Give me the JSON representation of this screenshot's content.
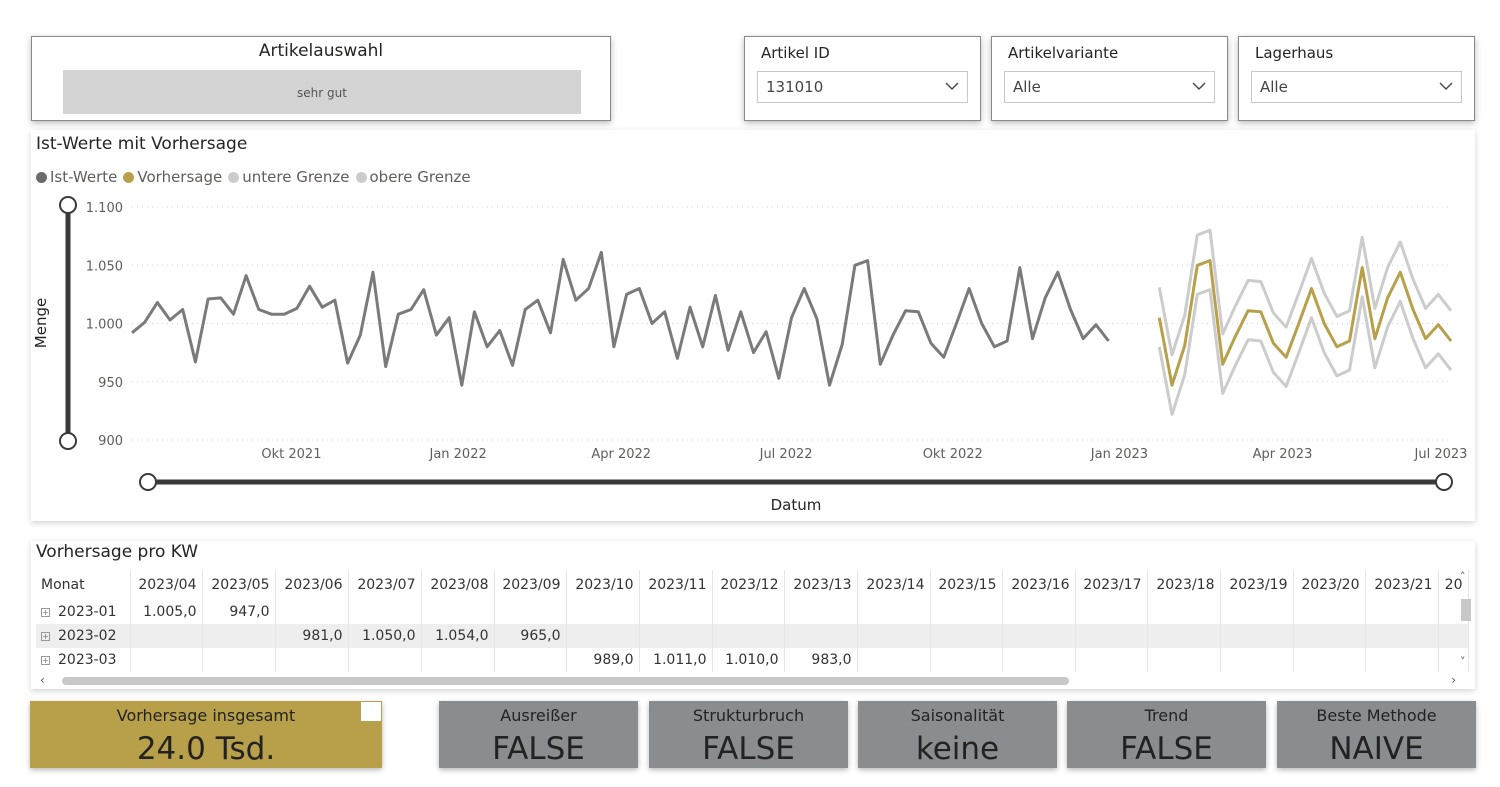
{
  "artikelauswahl": {
    "title": "Artikelauswahl",
    "value": "sehr gut"
  },
  "slicers": [
    {
      "label": "Artikel ID",
      "value": "131010"
    },
    {
      "label": "Artikelvariante",
      "value": "Alle"
    },
    {
      "label": "Lagerhaus",
      "value": "Alle"
    }
  ],
  "chart_title": "Ist-Werte mit Vorhersage",
  "legend": [
    "Ist-Werte",
    "Vorhersage",
    "untere Grenze",
    "obere Grenze"
  ],
  "colors": {
    "ist": "#7a7a7a",
    "vorhersage": "#b8a04a",
    "grenze": "#cccccc",
    "kpi_gold": "#b8a04a",
    "kpi_grey": "#8a8d8f"
  },
  "chart_data": {
    "type": "line",
    "title": "Ist-Werte mit Vorhersage",
    "xlabel": "Datum",
    "ylabel": "Menge",
    "ylim": [
      900,
      1100
    ],
    "yticks": [
      900,
      950,
      1000,
      1050,
      1100
    ],
    "ytick_labels": [
      "900",
      "950",
      "1.000",
      "1.050",
      "1.100"
    ],
    "xticks": [
      "2021-10-01",
      "2022-01-01",
      "2022-04-01",
      "2022-07-01",
      "2022-10-01",
      "2023-01-01",
      "2023-04-01",
      "2023-07-01"
    ],
    "xtick_labels": [
      "Okt 2021",
      "Jan 2022",
      "Apr 2022",
      "Jul 2022",
      "Okt 2022",
      "Jan 2023",
      "Apr 2023",
      "Jul 2023"
    ],
    "xlim": [
      "2021-07-05",
      "2023-07-03"
    ],
    "grid": true,
    "legend_position": "top-left",
    "series": [
      {
        "name": "Ist-Werte",
        "start": "2021-07-05",
        "step_days": 7,
        "values": [
          992,
          1001,
          1018,
          1003,
          1012,
          967,
          1021,
          1022,
          1008,
          1041,
          1012,
          1008,
          1008,
          1013,
          1032,
          1014,
          1020,
          966,
          990,
          1044,
          963,
          1008,
          1012,
          1029,
          990,
          1005,
          947,
          1010,
          980,
          994,
          964,
          1012,
          1020,
          992,
          1055,
          1020,
          1030,
          1061,
          980,
          1025,
          1030,
          1000,
          1010,
          970,
          1014,
          980,
          1024,
          977,
          1010,
          975,
          993,
          953,
          1005,
          1030,
          1004,
          947,
          982,
          1050,
          1054,
          965,
          990,
          1011,
          1010,
          983,
          971,
          1000,
          1030,
          1000,
          980,
          985,
          1048,
          987,
          1022,
          1044,
          1012,
          987,
          999,
          985
        ]
      },
      {
        "name": "Vorhersage",
        "start": "2023-01-23",
        "step_days": 7,
        "values": [
          1005,
          947,
          981,
          1050,
          1054,
          965,
          989,
          1011,
          1010,
          983,
          971,
          1000,
          1030,
          1000,
          980,
          985,
          1048,
          987,
          1022,
          1044,
          1012,
          987,
          999,
          985
        ]
      },
      {
        "name": "untere Grenze",
        "start": "2023-01-23",
        "step_days": 7,
        "values": [
          980,
          922,
          956,
          1025,
          1029,
          940,
          964,
          986,
          985,
          958,
          946,
          975,
          1005,
          975,
          955,
          960,
          1023,
          962,
          997,
          1019,
          987,
          962,
          974,
          960
        ]
      },
      {
        "name": "obere Grenze",
        "start": "2023-01-23",
        "step_days": 7,
        "values": [
          1031,
          973,
          1007,
          1076,
          1080,
          991,
          1015,
          1037,
          1036,
          1009,
          997,
          1026,
          1056,
          1026,
          1006,
          1011,
          1074,
          1013,
          1048,
          1070,
          1038,
          1013,
          1025,
          1011
        ]
      }
    ]
  },
  "table": {
    "title": "Vorhersage pro KW",
    "columns": [
      "Monat",
      "2023/04",
      "2023/05",
      "2023/06",
      "2023/07",
      "2023/08",
      "2023/09",
      "2023/10",
      "2023/11",
      "2023/12",
      "2023/13",
      "2023/14",
      "2023/15",
      "2023/16",
      "2023/17",
      "2023/18",
      "2023/19",
      "2023/20",
      "2023/21",
      "20"
    ],
    "rows": [
      [
        "2023-01",
        "1.005,0",
        "947,0",
        "",
        "",
        "",
        "",
        "",
        "",
        "",
        "",
        "",
        "",
        "",
        "",
        "",
        "",
        "",
        "",
        ""
      ],
      [
        "2023-02",
        "",
        "",
        "981,0",
        "1.050,0",
        "1.054,0",
        "965,0",
        "",
        "",
        "",
        "",
        "",
        "",
        "",
        "",
        "",
        "",
        "",
        "",
        ""
      ],
      [
        "2023-03",
        "",
        "",
        "",
        "",
        "",
        "",
        "989,0",
        "1.011,0",
        "1.010,0",
        "983,0",
        "",
        "",
        "",
        "",
        "",
        "",
        "",
        "",
        ""
      ]
    ]
  },
  "kpis": [
    {
      "label": "Vorhersage insgesamt",
      "value": "24.0 Tsd."
    },
    {
      "label": "Ausreißer",
      "value": "FALSE"
    },
    {
      "label": "Strukturbruch",
      "value": "FALSE"
    },
    {
      "label": "Saisonalität",
      "value": "keine"
    },
    {
      "label": "Trend",
      "value": "FALSE"
    },
    {
      "label": "Beste Methode",
      "value": "NAIVE"
    }
  ]
}
